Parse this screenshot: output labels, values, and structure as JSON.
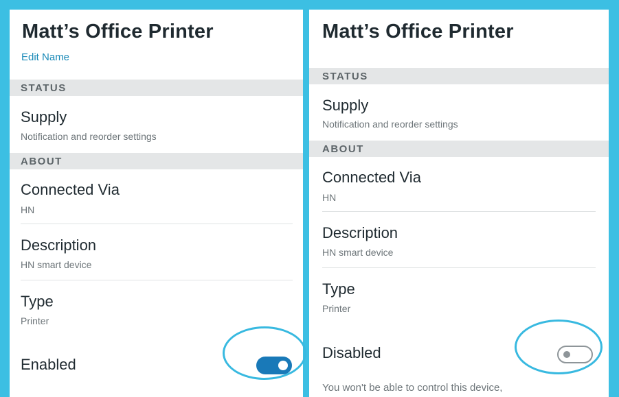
{
  "left_screen": {
    "title": "Matt’s Office Printer",
    "edit_name": "Edit Name",
    "status_header": "STATUS",
    "supply": {
      "title": "Supply",
      "subtitle": "Notification and reorder settings"
    },
    "about_header": "ABOUT",
    "connected_via": {
      "title": "Connected Via",
      "value": "HN"
    },
    "description": {
      "title": "Description",
      "value": "HN smart device"
    },
    "type": {
      "title": "Type",
      "value": "Printer"
    },
    "state": {
      "label": "Enabled",
      "toggle_on": true
    }
  },
  "right_screen": {
    "title": "Matt’s Office Printer",
    "status_header": "STATUS",
    "supply": {
      "title": "Supply",
      "subtitle": "Notification and reorder settings"
    },
    "about_header": "ABOUT",
    "connected_via": {
      "title": "Connected Via",
      "value": "HN"
    },
    "description": {
      "title": "Description",
      "value": "HN smart device"
    },
    "type": {
      "title": "Type",
      "value": "Printer"
    },
    "state": {
      "label": "Disabled",
      "toggle_on": false
    },
    "warning": "You won't be able to control this device,"
  },
  "colors": {
    "frame_border": "#3cbfe3",
    "highlight_circle": "#38b9e0",
    "toggle_on": "#1979b8",
    "link": "#1a8ab8",
    "section_bar": "#e4e6e7"
  }
}
